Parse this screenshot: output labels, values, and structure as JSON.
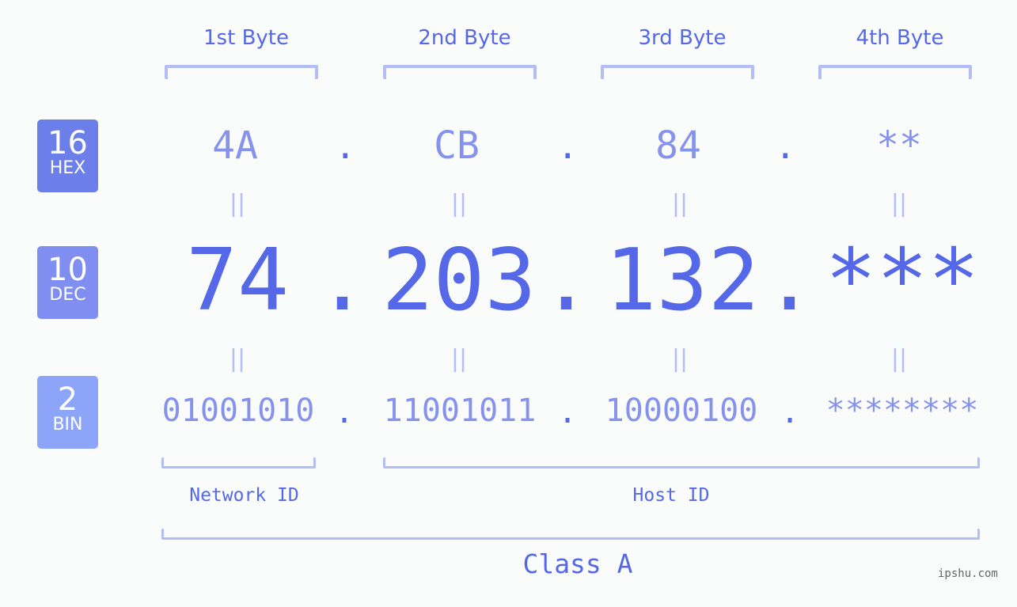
{
  "byte_headers": [
    "1st Byte",
    "2nd Byte",
    "3rd Byte",
    "4th Byte"
  ],
  "badges": [
    {
      "num": "16",
      "label": "HEX",
      "color": "#6c7ee9"
    },
    {
      "num": "10",
      "label": "DEC",
      "color": "#7f8ef0"
    },
    {
      "num": "2",
      "label": "BIN",
      "color": "#8da5f8"
    }
  ],
  "hex": [
    "4A",
    "CB",
    "84",
    "**"
  ],
  "dec": [
    "74",
    "203",
    "132",
    "***"
  ],
  "bin": [
    "01001010",
    "11001011",
    "10000100",
    "********"
  ],
  "separator": ".",
  "equals": "||",
  "network_label": "Network ID",
  "host_label": "Host ID",
  "class_label": "Class A",
  "watermark": "ipshu.com",
  "colors": {
    "accent": "#5468e8",
    "light": "#8693ec",
    "bracket": "#b3bdf6"
  }
}
